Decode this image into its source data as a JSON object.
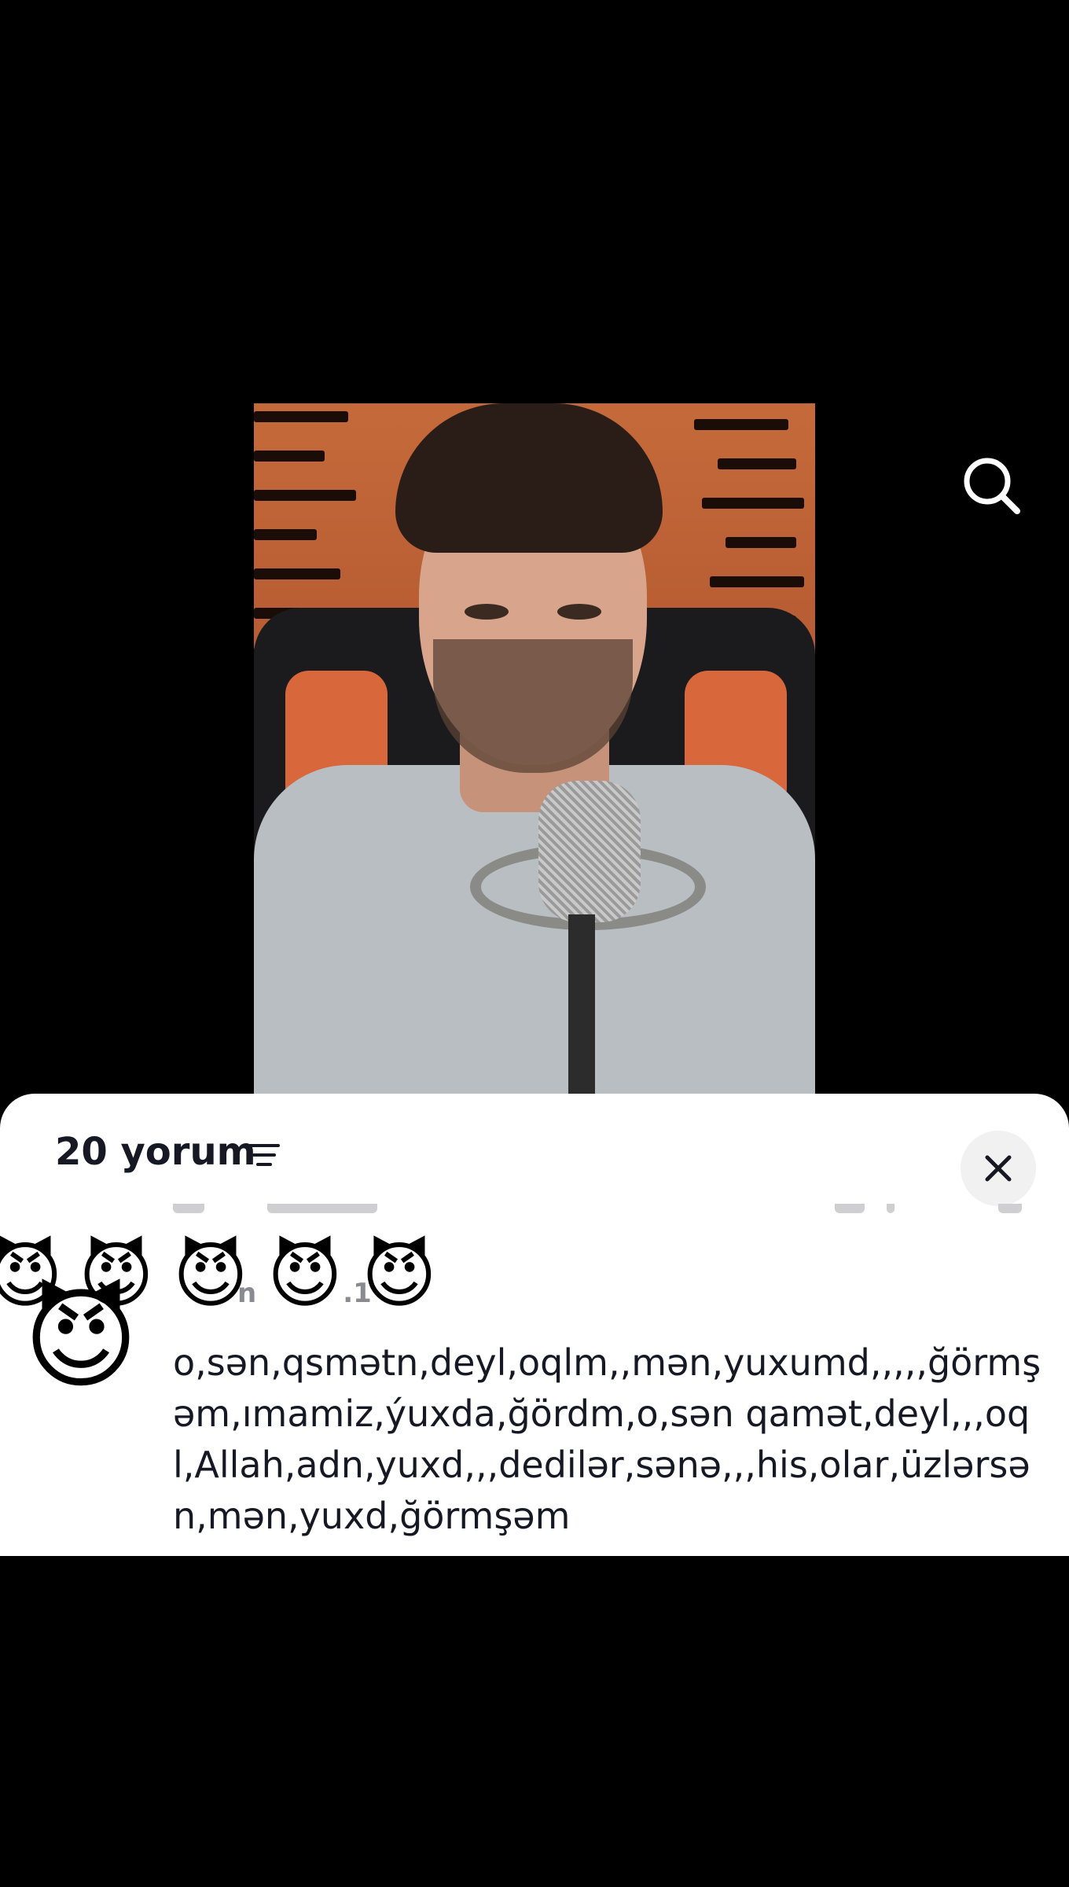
{
  "search": {
    "icon": "search-icon",
    "color": "#ffffff"
  },
  "comments_sheet": {
    "count_label": "20 yorum",
    "sort_icon": "sort-lines-icon",
    "close_icon": "close-icon",
    "background": "#ffffff",
    "text_color": "#161823"
  },
  "comment": {
    "author_partial": "n",
    "date_partial": ".1",
    "avatar_emoji": "😈",
    "emoji_row": [
      "😈",
      "😈",
      "😈",
      "😈",
      "😈"
    ],
    "text": "o,sən,qsmətn,deyl,oqlm,,mən,yuxumd,,,,,ğörmşəm,ımamiz,ýuxda,ğördm,o,sən qamət,deyl,,,oql,Allah,adn,yuxd,,,dedilər,sənə,,,his,olar,üzlərsən,mən,yuxd,ğörmşəm"
  }
}
